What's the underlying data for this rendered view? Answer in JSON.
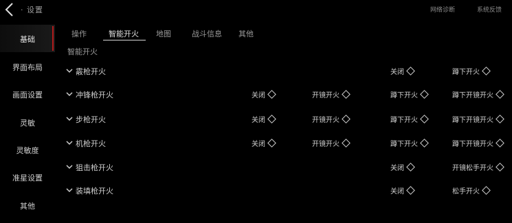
{
  "header": {
    "back_icon": "chevron-left-icon",
    "title": "· 设置",
    "right_items": [
      "网络诊断",
      "系统反馈"
    ]
  },
  "sidebar": {
    "items": [
      {
        "label": "基础",
        "active": true
      },
      {
        "label": "界面布局"
      },
      {
        "label": "画面设置"
      },
      {
        "label": "灵敏"
      },
      {
        "label": "灵敏度"
      },
      {
        "label": "准星设置"
      },
      {
        "label": "其他"
      }
    ]
  },
  "tabs": [
    {
      "label": "操作"
    },
    {
      "label": "智能开火",
      "active": true
    },
    {
      "label": "地图"
    },
    {
      "label": "战斗信息"
    },
    {
      "label": "其他"
    }
  ],
  "section_title": "智能开火",
  "rows": [
    {
      "label": "霰枪开火",
      "options": [
        {
          "label": "关闭",
          "slot": 2
        },
        {
          "label": "蹲下开火",
          "slot": 3
        }
      ]
    },
    {
      "label": "冲锋枪开火",
      "options": [
        {
          "label": "关闭",
          "slot": 0
        },
        {
          "label": "开镜开火",
          "slot": 1
        },
        {
          "label": "蹲下开火",
          "slot": 2
        },
        {
          "label": "蹲下开镜开火",
          "slot": 3
        }
      ]
    },
    {
      "label": "步枪开火",
      "options": [
        {
          "label": "关闭",
          "slot": 0
        },
        {
          "label": "开镜开火",
          "slot": 1
        },
        {
          "label": "蹲下开火",
          "slot": 2
        },
        {
          "label": "蹲下开镜开火",
          "slot": 3
        }
      ]
    },
    {
      "label": "机枪开火",
      "options": [
        {
          "label": "关闭",
          "slot": 0
        },
        {
          "label": "开镜开火",
          "slot": 1
        },
        {
          "label": "蹲下开火",
          "slot": 2
        },
        {
          "label": "蹲下开镜开火",
          "slot": 3
        }
      ]
    },
    {
      "label": "狙击枪开火",
      "options": [
        {
          "label": "关闭",
          "slot": 2
        },
        {
          "label": "开镜松手开火",
          "slot": 3
        }
      ]
    },
    {
      "label": "装填枪开火",
      "options": [
        {
          "label": "关闭",
          "slot": 2
        },
        {
          "label": "松手开火",
          "slot": 3
        }
      ]
    }
  ]
}
